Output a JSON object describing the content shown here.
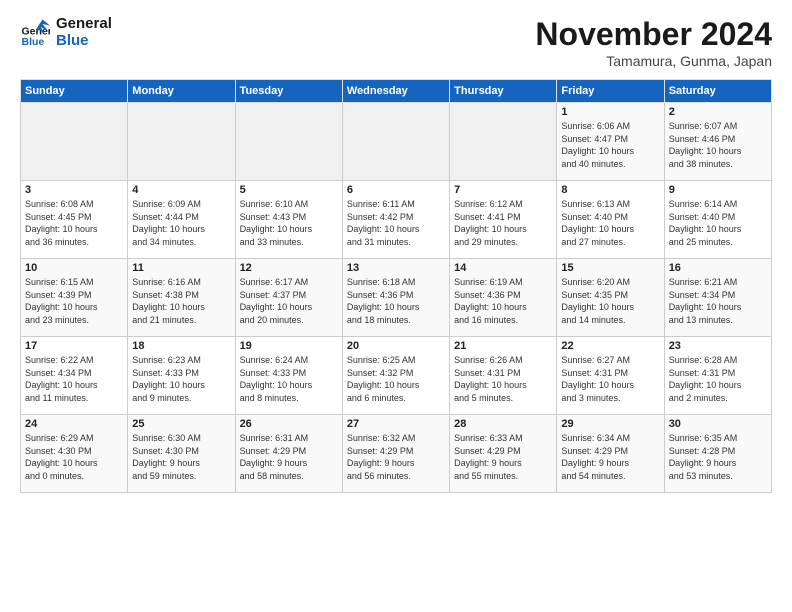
{
  "logo": {
    "line1": "General",
    "line2": "Blue"
  },
  "title": "November 2024",
  "location": "Tamamura, Gunma, Japan",
  "headers": [
    "Sunday",
    "Monday",
    "Tuesday",
    "Wednesday",
    "Thursday",
    "Friday",
    "Saturday"
  ],
  "weeks": [
    [
      {
        "day": "",
        "info": ""
      },
      {
        "day": "",
        "info": ""
      },
      {
        "day": "",
        "info": ""
      },
      {
        "day": "",
        "info": ""
      },
      {
        "day": "",
        "info": ""
      },
      {
        "day": "1",
        "info": "Sunrise: 6:06 AM\nSunset: 4:47 PM\nDaylight: 10 hours\nand 40 minutes."
      },
      {
        "day": "2",
        "info": "Sunrise: 6:07 AM\nSunset: 4:46 PM\nDaylight: 10 hours\nand 38 minutes."
      }
    ],
    [
      {
        "day": "3",
        "info": "Sunrise: 6:08 AM\nSunset: 4:45 PM\nDaylight: 10 hours\nand 36 minutes."
      },
      {
        "day": "4",
        "info": "Sunrise: 6:09 AM\nSunset: 4:44 PM\nDaylight: 10 hours\nand 34 minutes."
      },
      {
        "day": "5",
        "info": "Sunrise: 6:10 AM\nSunset: 4:43 PM\nDaylight: 10 hours\nand 33 minutes."
      },
      {
        "day": "6",
        "info": "Sunrise: 6:11 AM\nSunset: 4:42 PM\nDaylight: 10 hours\nand 31 minutes."
      },
      {
        "day": "7",
        "info": "Sunrise: 6:12 AM\nSunset: 4:41 PM\nDaylight: 10 hours\nand 29 minutes."
      },
      {
        "day": "8",
        "info": "Sunrise: 6:13 AM\nSunset: 4:40 PM\nDaylight: 10 hours\nand 27 minutes."
      },
      {
        "day": "9",
        "info": "Sunrise: 6:14 AM\nSunset: 4:40 PM\nDaylight: 10 hours\nand 25 minutes."
      }
    ],
    [
      {
        "day": "10",
        "info": "Sunrise: 6:15 AM\nSunset: 4:39 PM\nDaylight: 10 hours\nand 23 minutes."
      },
      {
        "day": "11",
        "info": "Sunrise: 6:16 AM\nSunset: 4:38 PM\nDaylight: 10 hours\nand 21 minutes."
      },
      {
        "day": "12",
        "info": "Sunrise: 6:17 AM\nSunset: 4:37 PM\nDaylight: 10 hours\nand 20 minutes."
      },
      {
        "day": "13",
        "info": "Sunrise: 6:18 AM\nSunset: 4:36 PM\nDaylight: 10 hours\nand 18 minutes."
      },
      {
        "day": "14",
        "info": "Sunrise: 6:19 AM\nSunset: 4:36 PM\nDaylight: 10 hours\nand 16 minutes."
      },
      {
        "day": "15",
        "info": "Sunrise: 6:20 AM\nSunset: 4:35 PM\nDaylight: 10 hours\nand 14 minutes."
      },
      {
        "day": "16",
        "info": "Sunrise: 6:21 AM\nSunset: 4:34 PM\nDaylight: 10 hours\nand 13 minutes."
      }
    ],
    [
      {
        "day": "17",
        "info": "Sunrise: 6:22 AM\nSunset: 4:34 PM\nDaylight: 10 hours\nand 11 minutes."
      },
      {
        "day": "18",
        "info": "Sunrise: 6:23 AM\nSunset: 4:33 PM\nDaylight: 10 hours\nand 9 minutes."
      },
      {
        "day": "19",
        "info": "Sunrise: 6:24 AM\nSunset: 4:33 PM\nDaylight: 10 hours\nand 8 minutes."
      },
      {
        "day": "20",
        "info": "Sunrise: 6:25 AM\nSunset: 4:32 PM\nDaylight: 10 hours\nand 6 minutes."
      },
      {
        "day": "21",
        "info": "Sunrise: 6:26 AM\nSunset: 4:31 PM\nDaylight: 10 hours\nand 5 minutes."
      },
      {
        "day": "22",
        "info": "Sunrise: 6:27 AM\nSunset: 4:31 PM\nDaylight: 10 hours\nand 3 minutes."
      },
      {
        "day": "23",
        "info": "Sunrise: 6:28 AM\nSunset: 4:31 PM\nDaylight: 10 hours\nand 2 minutes."
      }
    ],
    [
      {
        "day": "24",
        "info": "Sunrise: 6:29 AM\nSunset: 4:30 PM\nDaylight: 10 hours\nand 0 minutes."
      },
      {
        "day": "25",
        "info": "Sunrise: 6:30 AM\nSunset: 4:30 PM\nDaylight: 9 hours\nand 59 minutes."
      },
      {
        "day": "26",
        "info": "Sunrise: 6:31 AM\nSunset: 4:29 PM\nDaylight: 9 hours\nand 58 minutes."
      },
      {
        "day": "27",
        "info": "Sunrise: 6:32 AM\nSunset: 4:29 PM\nDaylight: 9 hours\nand 56 minutes."
      },
      {
        "day": "28",
        "info": "Sunrise: 6:33 AM\nSunset: 4:29 PM\nDaylight: 9 hours\nand 55 minutes."
      },
      {
        "day": "29",
        "info": "Sunrise: 6:34 AM\nSunset: 4:29 PM\nDaylight: 9 hours\nand 54 minutes."
      },
      {
        "day": "30",
        "info": "Sunrise: 6:35 AM\nSunset: 4:28 PM\nDaylight: 9 hours\nand 53 minutes."
      }
    ]
  ]
}
